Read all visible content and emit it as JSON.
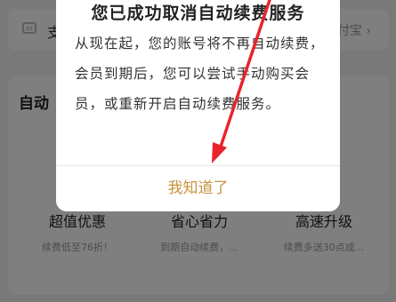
{
  "background": {
    "pay_method": {
      "left_label": "支",
      "right_label": "付宝",
      "chevron": "›"
    },
    "auto_section": {
      "title": "自动",
      "features": [
        {
          "title": "超值优惠",
          "subtitle": "续费低至76折！"
        },
        {
          "title": "省心省力",
          "subtitle": "到期自动续费，..."
        },
        {
          "title": "高速升级",
          "subtitle": "续费多送30点成..."
        }
      ]
    }
  },
  "dialog": {
    "title": "您已成功取消自动续费服务",
    "message": "从现在起，您的账号将不再自动续费，会员到期后，您可以尝试手动购买会员，或重新开启自动续费服务。",
    "confirm_button": "我知道了"
  },
  "colors": {
    "accent": "#c7933f",
    "arrow": "#e8242b"
  }
}
